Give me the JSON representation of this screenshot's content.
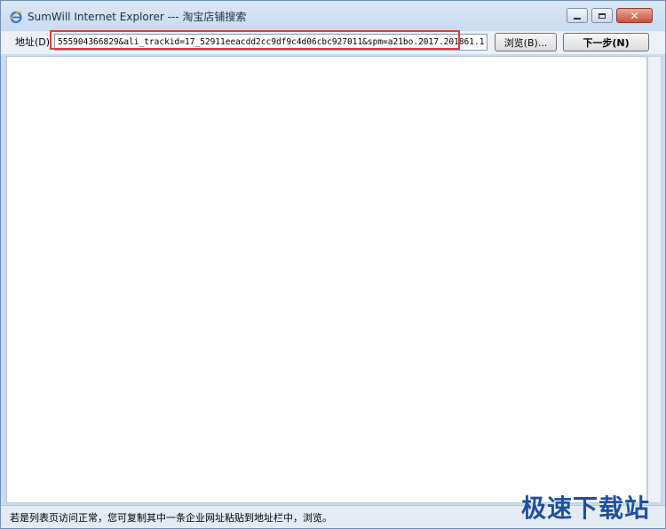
{
  "window": {
    "title": "SumWill Internet Explorer --- 淘宝店铺搜索",
    "icon": "ie-icon"
  },
  "toolbar": {
    "address_label": "地址(D)",
    "address_value": "555904366829&ali_trackid=17_52911eeacdd2cc9df9c4d06cbc927011&spm=a21bo.2017.201861.1",
    "browse_label": "浏览(B)...",
    "next_label": "下一步(N)"
  },
  "status": {
    "text": "若是列表页访问正常，您可复制其中一条企业网址粘贴到地址栏中，浏览。"
  },
  "watermark": {
    "text": "极速下载站"
  },
  "colors": {
    "highlight": "#e03c3c",
    "titlebar": "#c8dbf0"
  }
}
